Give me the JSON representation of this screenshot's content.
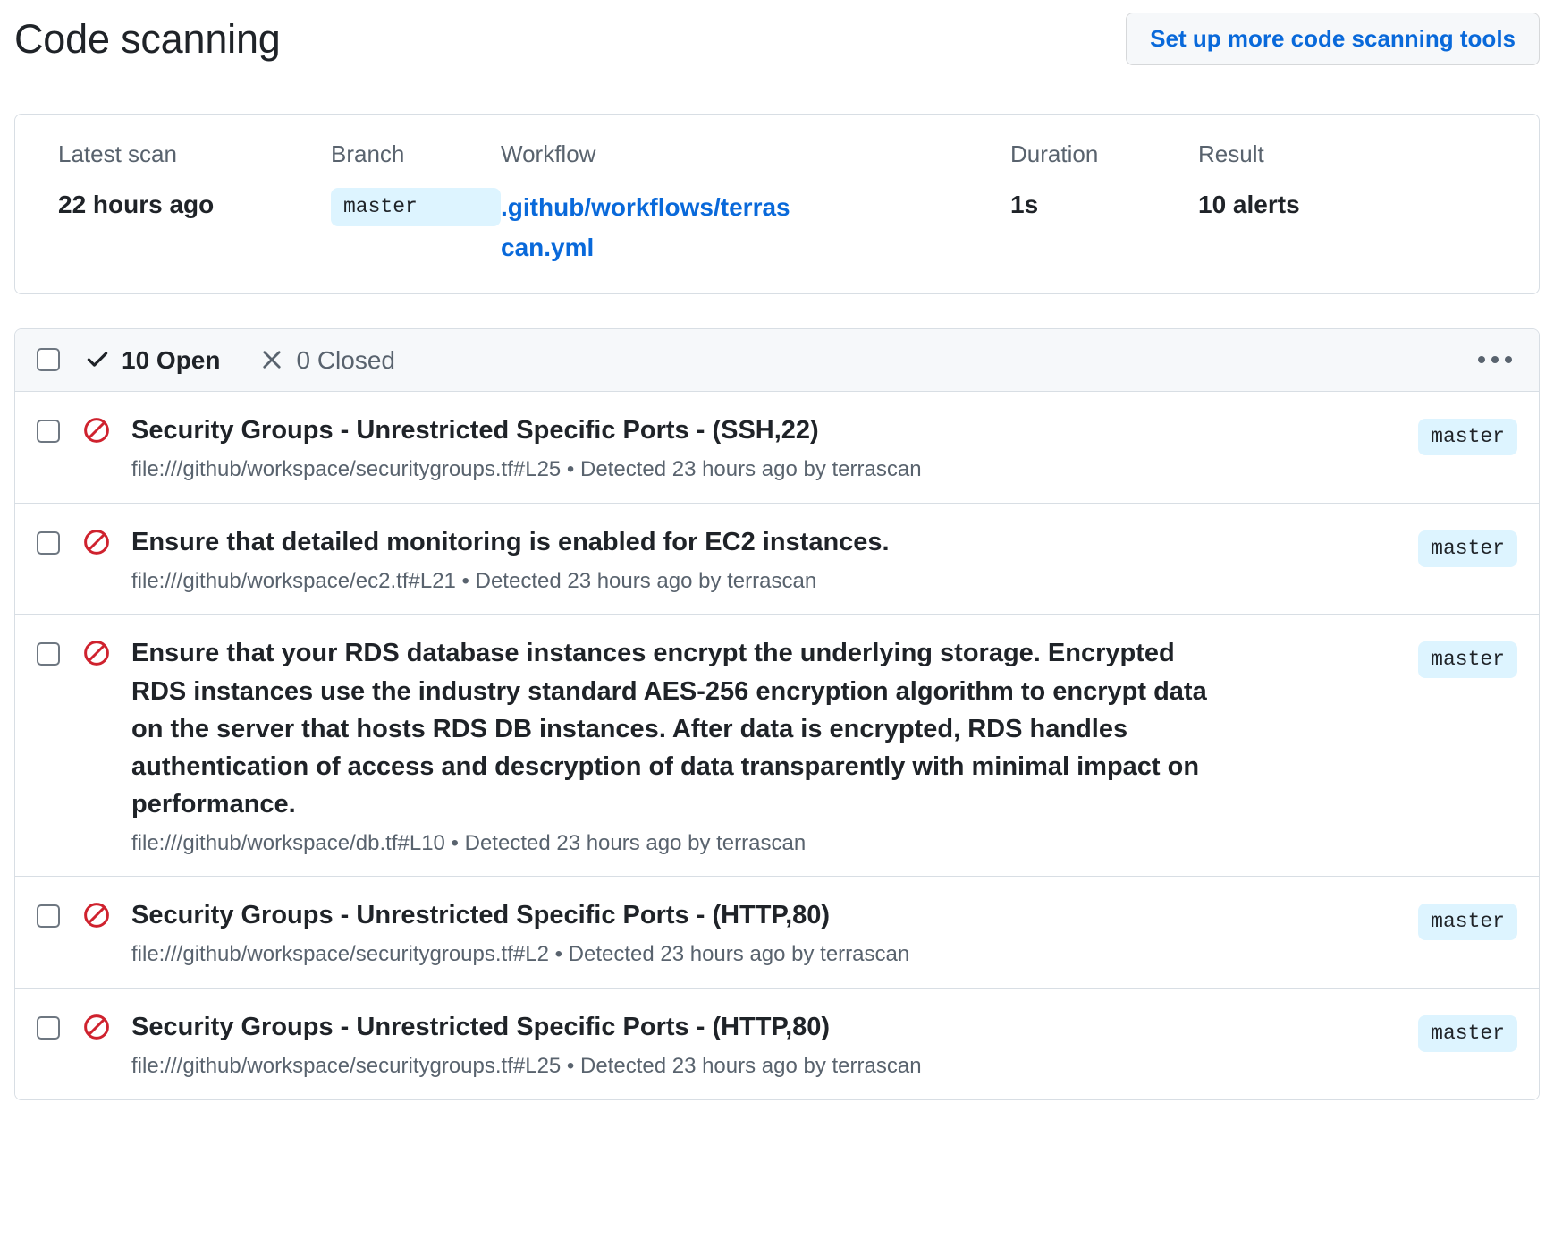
{
  "header": {
    "title": "Code scanning",
    "setup_button": "Set up more code scanning tools"
  },
  "scan_summary": {
    "latest_scan": {
      "label": "Latest scan",
      "value": "22 hours ago"
    },
    "branch": {
      "label": "Branch",
      "value": "master"
    },
    "workflow": {
      "label": "Workflow",
      "line1": ".github/workflows",
      "line2": "/terrascan.yml"
    },
    "duration": {
      "label": "Duration",
      "value": "1s"
    },
    "result": {
      "label": "Result",
      "value": "10 alerts"
    }
  },
  "toolbar": {
    "open_label": "10 Open",
    "closed_label": "0 Closed",
    "open_icon": "check-icon",
    "closed_icon": "x-icon",
    "more_icon": "kebab-horizontal-icon"
  },
  "alerts": [
    {
      "icon": "blocked-alert-icon",
      "title": "Security Groups - Unrestricted Specific Ports - (SSH,22)",
      "meta": "file:///github/workspace/securitygroups.tf#L25 • Detected 23 hours ago by terrascan",
      "branch": "master"
    },
    {
      "icon": "blocked-alert-icon",
      "title": "Ensure that detailed monitoring is enabled for EC2 instances.",
      "meta": "file:///github/workspace/ec2.tf#L21 • Detected 23 hours ago by terrascan",
      "branch": "master"
    },
    {
      "icon": "blocked-alert-icon",
      "title": "Ensure that your RDS database instances encrypt the underlying storage. Encrypted RDS instances use the industry standard AES-256 encryption algorithm to encrypt data on the server that hosts RDS DB instances. After data is encrypted, RDS handles authentication of access and descryption of data transparently with minimal impact on performance.",
      "meta": "file:///github/workspace/db.tf#L10 • Detected 23 hours ago by terrascan",
      "branch": "master"
    },
    {
      "icon": "blocked-alert-icon",
      "title": "Security Groups - Unrestricted Specific Ports - (HTTP,80)",
      "meta": "file:///github/workspace/securitygroups.tf#L2 • Detected 23 hours ago by terrascan",
      "branch": "master"
    },
    {
      "icon": "blocked-alert-icon",
      "title": "Security Groups - Unrestricted Specific Ports - (HTTP,80)",
      "meta": "file:///github/workspace/securitygroups.tf#L25 • Detected 23 hours ago by terrascan",
      "branch": "master"
    }
  ],
  "colors": {
    "link": "#0969da",
    "alert_red": "#cf222e",
    "text": "#1F2328",
    "muted": "#59636e",
    "border": "#d8dee4",
    "chip_bg": "#ddf4ff",
    "toolbar_bg": "#f6f8fa"
  }
}
